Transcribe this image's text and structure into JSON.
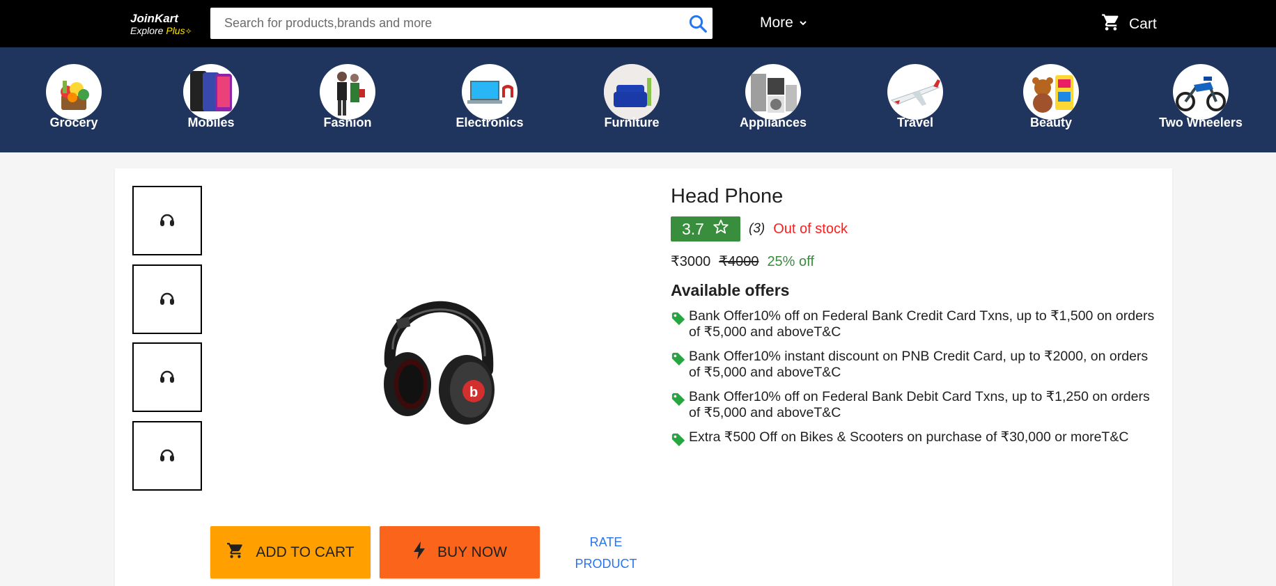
{
  "header": {
    "logo_name": "JoinKart",
    "logo_tagline": "Explore",
    "logo_plus": "Plus",
    "search_placeholder": "Search for products,brands and more",
    "more_label": "More",
    "cart_label": "Cart"
  },
  "categories": [
    {
      "label": "Grocery",
      "icon": "grocery-icon"
    },
    {
      "label": "Mobiles",
      "icon": "mobiles-icon"
    },
    {
      "label": "Fashion",
      "icon": "fashion-icon"
    },
    {
      "label": "Electronics",
      "icon": "electronics-icon"
    },
    {
      "label": "Furniture",
      "icon": "furniture-icon"
    },
    {
      "label": "Appliances",
      "icon": "appliances-icon"
    },
    {
      "label": "Travel",
      "icon": "travel-icon"
    },
    {
      "label": "Beauty",
      "icon": "beauty-icon"
    },
    {
      "label": "Two Wheelers",
      "icon": "two-wheelers-icon"
    }
  ],
  "product": {
    "title": "Head Phone",
    "rating": "3.7",
    "reviews": "(3)",
    "stock_status": "Out of stock",
    "price": "₹3000",
    "mrp": "₹4000",
    "discount": "25% off",
    "offers_heading": "Available offers",
    "offers": [
      "Bank Offer10% off on Federal Bank Credit Card Txns, up to ₹1,500 on orders of ₹5,000 and aboveT&C",
      "Bank Offer10% instant discount on PNB Credit Card, up to ₹2000, on orders of ₹5,000 and aboveT&C",
      "Bank Offer10% off on Federal Bank Debit Card Txns, up to ₹1,250 on orders of ₹5,000 and aboveT&C",
      "Extra ₹500 Off on Bikes & Scooters on purchase of ₹30,000 or moreT&C"
    ],
    "add_to_cart_label": "ADD TO CART",
    "buy_now_label": "BUY NOW",
    "rate_label_line1": "RATE",
    "rate_label_line2": "PRODUCT"
  },
  "colors": {
    "header_bg": "#000000",
    "category_bg": "#1f355e",
    "rating_green": "#388e3c",
    "out_of_stock": "#ff1c1c",
    "add_to_cart": "#ff9f00",
    "buy_now": "#fb641b",
    "link_blue": "#2874f0"
  }
}
